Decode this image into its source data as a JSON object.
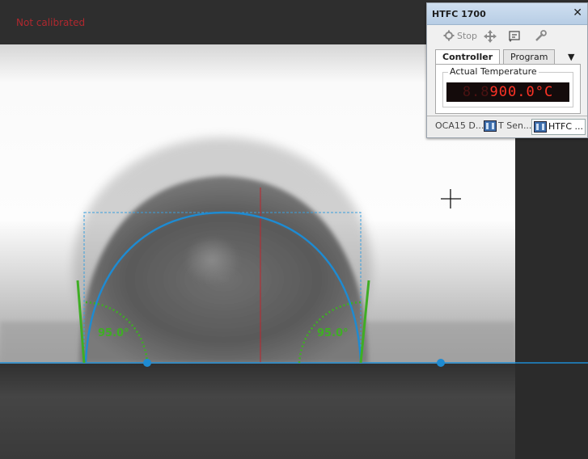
{
  "status_text": "Not calibrated",
  "measurement": {
    "left_angle_label": "95.0°",
    "right_angle_label": "95.0°"
  },
  "panel": {
    "title": "HTFC 1700",
    "close_symbol": "✕",
    "toolbar": {
      "stop_label": "Stop",
      "icons": [
        "stop-icon",
        "move-icon",
        "download-icon",
        "tools-icon"
      ]
    },
    "tabs": [
      {
        "label": "Controller",
        "active": true
      },
      {
        "label": "Program",
        "active": false
      }
    ],
    "tab_menu_symbol": "▼",
    "group_label": "Actual Temperature",
    "display_ghost": "8.8",
    "display_value": "900.0°C",
    "bottom_tabs": [
      {
        "label": "OCA15 D...",
        "active": false
      },
      {
        "label": "T Sen...",
        "active": false
      },
      {
        "label": "HTFC ...",
        "active": true
      }
    ]
  },
  "colors": {
    "status": "#b0282e",
    "fit_curve": "#1e8bd2",
    "tangent": "#3fae24",
    "angle_label": "#3fae24",
    "centerline": "#c0242c",
    "display_segment": "#ff3326"
  }
}
